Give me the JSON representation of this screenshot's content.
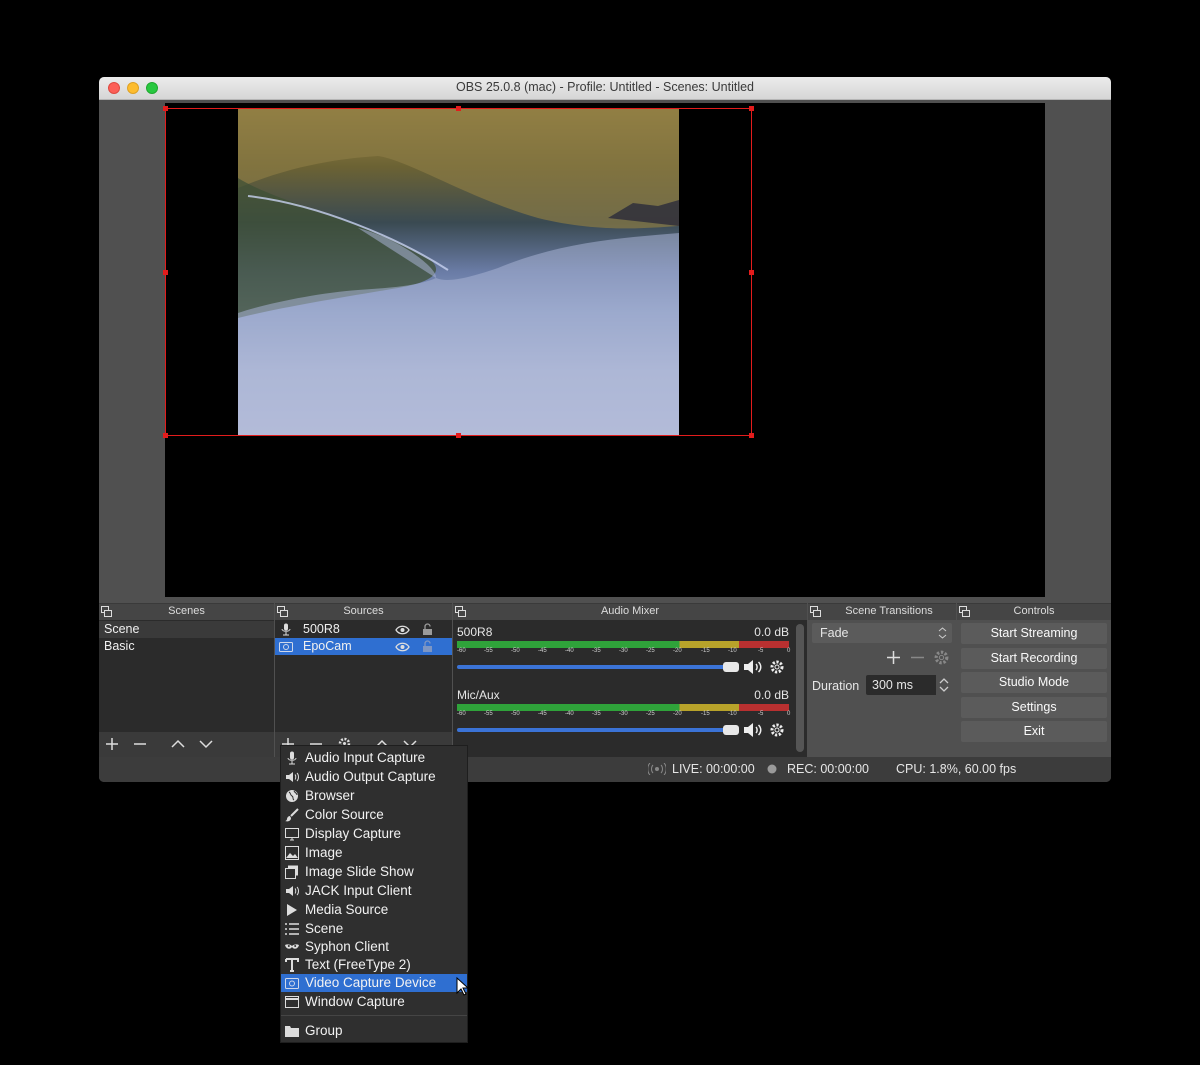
{
  "window": {
    "title": "OBS 25.0.8 (mac) - Profile: Untitled - Scenes: Untitled"
  },
  "docks": {
    "scenes": {
      "title": "Scenes",
      "items": [
        "Scene",
        "Basic"
      ]
    },
    "sources": {
      "title": "Sources",
      "items": [
        {
          "label": "500R8",
          "icon": "microphone-icon"
        },
        {
          "label": "EpoCam",
          "icon": "camera-icon"
        }
      ]
    },
    "audio_mixer": {
      "title": "Audio Mixer",
      "channels": [
        {
          "name": "500R8",
          "level": "0.0 dB"
        },
        {
          "name": "Mic/Aux",
          "level": "0.0 dB"
        }
      ],
      "ticks": [
        "-60",
        "-55",
        "-50",
        "-45",
        "-40",
        "-35",
        "-30",
        "-25",
        "-20",
        "-15",
        "-10",
        "-5",
        "0"
      ]
    },
    "scene_transitions": {
      "title": "Scene Transitions",
      "transition": "Fade",
      "duration_label": "Duration",
      "duration_value": "300 ms"
    },
    "controls": {
      "title": "Controls",
      "buttons": [
        "Start Streaming",
        "Start Recording",
        "Studio Mode",
        "Settings",
        "Exit"
      ]
    }
  },
  "status": {
    "live": "LIVE: 00:00:00",
    "rec": "REC: 00:00:00",
    "cpu": "CPU: 1.8%, 60.00 fps"
  },
  "add_source_menu": {
    "items": [
      {
        "label": "Audio Input Capture",
        "icon": "microphone-icon"
      },
      {
        "label": "Audio Output Capture",
        "icon": "speaker-icon"
      },
      {
        "label": "Browser",
        "icon": "globe-icon"
      },
      {
        "label": "Color Source",
        "icon": "paint-brush-icon"
      },
      {
        "label": "Display Capture",
        "icon": "monitor-icon"
      },
      {
        "label": "Image",
        "icon": "image-icon"
      },
      {
        "label": "Image Slide Show",
        "icon": "slideshow-icon"
      },
      {
        "label": "JACK Input Client",
        "icon": "speaker-icon"
      },
      {
        "label": "Media Source",
        "icon": "play-icon"
      },
      {
        "label": "Scene",
        "icon": "list-icon"
      },
      {
        "label": "Syphon Client",
        "icon": "mask-icon"
      },
      {
        "label": "Text (FreeType 2)",
        "icon": "text-icon"
      },
      {
        "label": "Video Capture Device",
        "icon": "camera-icon"
      },
      {
        "label": "Window Capture",
        "icon": "window-icon"
      },
      {
        "label": "Group",
        "icon": "folder-icon"
      }
    ],
    "selected": "Video Capture Device"
  },
  "colors": {
    "selection": "#2f6fd1",
    "bounding_box": "#e31c1c",
    "meter_green": "#2fa33a",
    "meter_yellow": "#b8a32a",
    "meter_red": "#b83030"
  }
}
